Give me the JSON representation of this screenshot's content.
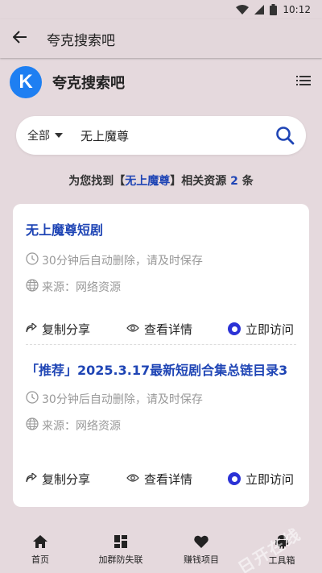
{
  "status_bar": {
    "time": "10:12"
  },
  "app_bar": {
    "title": "夸克搜索吧"
  },
  "brand": {
    "logo_letter": "K",
    "name": "夸克搜索吧"
  },
  "search": {
    "category": "全部",
    "query": "无上魔尊"
  },
  "summary": {
    "prefix": "为您找到【",
    "keyword": "无上魔尊",
    "middle": "】相关资源 ",
    "count": "2",
    "suffix": " 条"
  },
  "results": [
    {
      "title": "无上魔尊短剧",
      "expire_note": "30分钟后自动删除，请及时保存",
      "source": "来源：网络资源",
      "copy_label": "复制分享",
      "detail_label": "查看详情",
      "visit_label": "立即访问"
    },
    {
      "title": "「推荐」2025.3.17最新短剧合集总链目录3",
      "expire_note": "30分钟后自动删除，请及时保存",
      "source": "来源：网络资源",
      "copy_label": "复制分享",
      "detail_label": "查看详情",
      "visit_label": "立即访问"
    }
  ],
  "bottom_nav": [
    {
      "label": "首页",
      "icon": "home-icon"
    },
    {
      "label": "加群防失联",
      "icon": "grid-icon"
    },
    {
      "label": "赚钱项目",
      "icon": "heart-icon"
    },
    {
      "label": "工具箱",
      "icon": "android-icon"
    }
  ],
  "watermark": "日开在线",
  "colors": {
    "accent": "#1f45b5",
    "logo": "#1e7ff2",
    "visit": "#2b32d6",
    "background": "#e5d9dd"
  }
}
